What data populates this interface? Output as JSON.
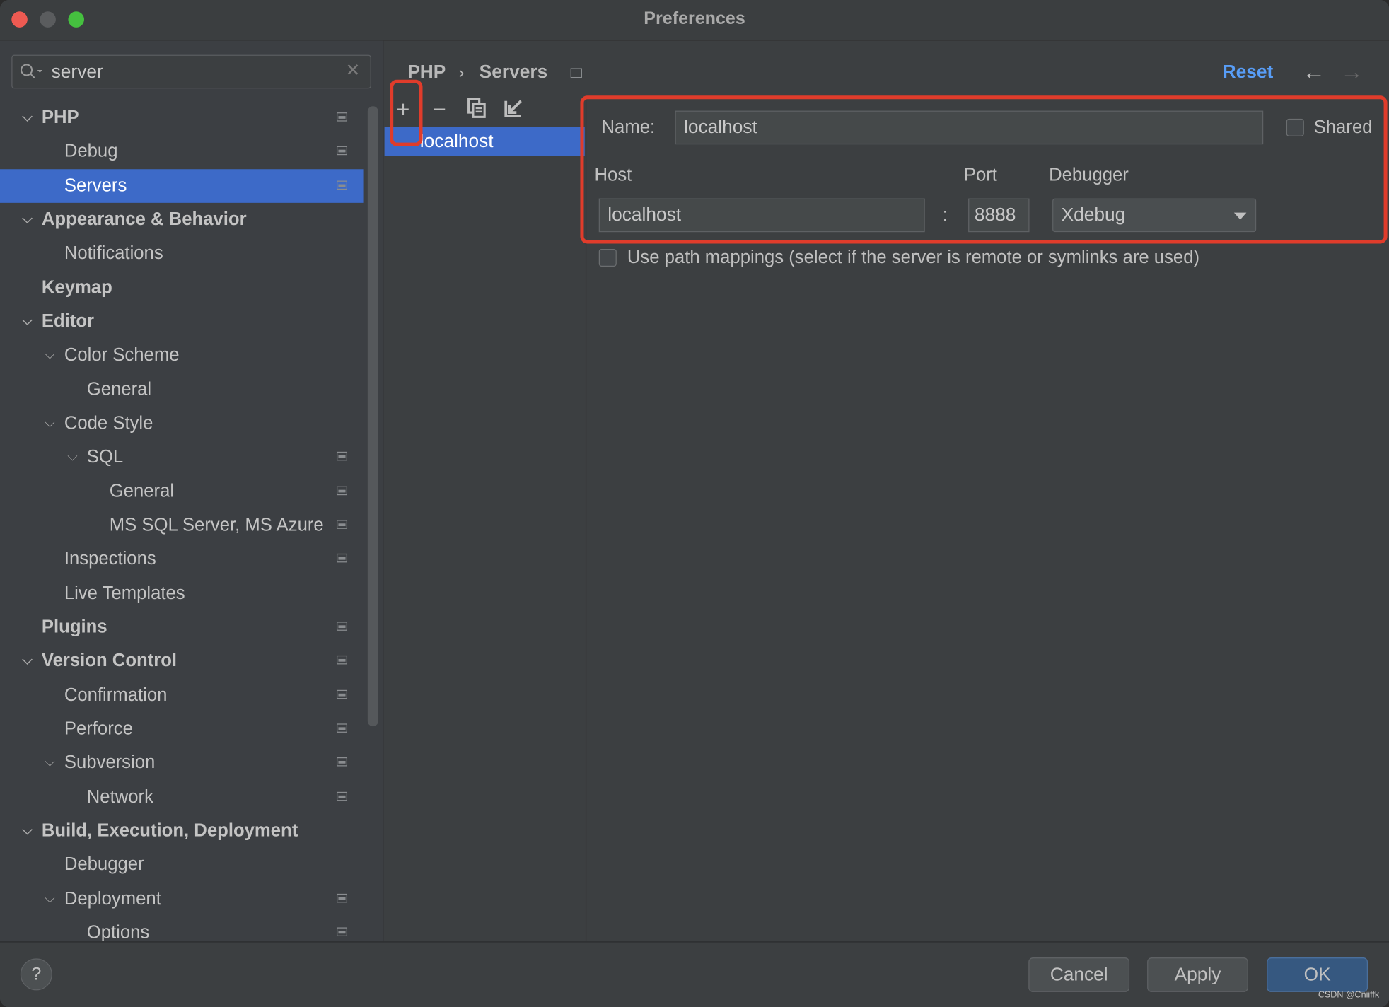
{
  "window": {
    "title": "Preferences"
  },
  "search": {
    "value": "server"
  },
  "tree": [
    {
      "label": "PHP",
      "level": 0,
      "expanded": true,
      "bold": true,
      "project": true
    },
    {
      "label": "Debug",
      "level": 1,
      "project": true
    },
    {
      "label": "Servers",
      "level": 1,
      "project": true,
      "selected": true
    },
    {
      "label": "Appearance & Behavior",
      "level": 0,
      "expanded": true,
      "bold": true
    },
    {
      "label": "Notifications",
      "level": 1
    },
    {
      "label": "Keymap",
      "level": 0,
      "bold": true
    },
    {
      "label": "Editor",
      "level": 0,
      "expanded": true,
      "bold": true
    },
    {
      "label": "Color Scheme",
      "level": 1,
      "expanded": true
    },
    {
      "label": "General",
      "level": 2
    },
    {
      "label": "Code Style",
      "level": 1,
      "expanded": true
    },
    {
      "label": "SQL",
      "level": 2,
      "expanded": true,
      "project": true
    },
    {
      "label": "General",
      "level": 3,
      "project": true
    },
    {
      "label": "MS SQL Server, MS Azure",
      "level": 3,
      "project": true
    },
    {
      "label": "Inspections",
      "level": 1,
      "project": true
    },
    {
      "label": "Live Templates",
      "level": 1
    },
    {
      "label": "Plugins",
      "level": 0,
      "bold": true,
      "project": true
    },
    {
      "label": "Version Control",
      "level": 0,
      "expanded": true,
      "bold": true,
      "project": true
    },
    {
      "label": "Confirmation",
      "level": 1,
      "project": true
    },
    {
      "label": "Perforce",
      "level": 1,
      "project": true
    },
    {
      "label": "Subversion",
      "level": 1,
      "expanded": true,
      "project": true
    },
    {
      "label": "Network",
      "level": 2,
      "project": true
    },
    {
      "label": "Build, Execution, Deployment",
      "level": 0,
      "expanded": true,
      "bold": true
    },
    {
      "label": "Debugger",
      "level": 1
    },
    {
      "label": "Deployment",
      "level": 1,
      "expanded": true,
      "project": true
    },
    {
      "label": "Options",
      "level": 2,
      "project": true
    }
  ],
  "breadcrumb": {
    "parent": "PHP",
    "separator": "›",
    "current": "Servers"
  },
  "header": {
    "reset": "Reset",
    "accent": "#589df6"
  },
  "toolbar": {
    "add": "+",
    "remove": "−",
    "copy": "copy-icon",
    "import": "import-icon"
  },
  "servers": {
    "items": [
      "localhost"
    ]
  },
  "form": {
    "name_label": "Name:",
    "name_value": "localhost",
    "shared_label": "Shared",
    "shared_checked": false,
    "host_label": "Host",
    "host_value": "localhost",
    "port_label": "Port",
    "port_value": "8888",
    "colon": ":",
    "debugger_label": "Debugger",
    "debugger_value": "Xdebug",
    "path_mappings_label": "Use path mappings (select if the server is remote or symlinks are used)",
    "path_mappings_checked": false
  },
  "footer": {
    "help": "?",
    "cancel": "Cancel",
    "apply": "Apply",
    "ok": "OK",
    "watermark": "CSDN @Cniiffk"
  },
  "colors": {
    "selection": "#3d6ac8",
    "highlight_box": "#e03c2b"
  }
}
